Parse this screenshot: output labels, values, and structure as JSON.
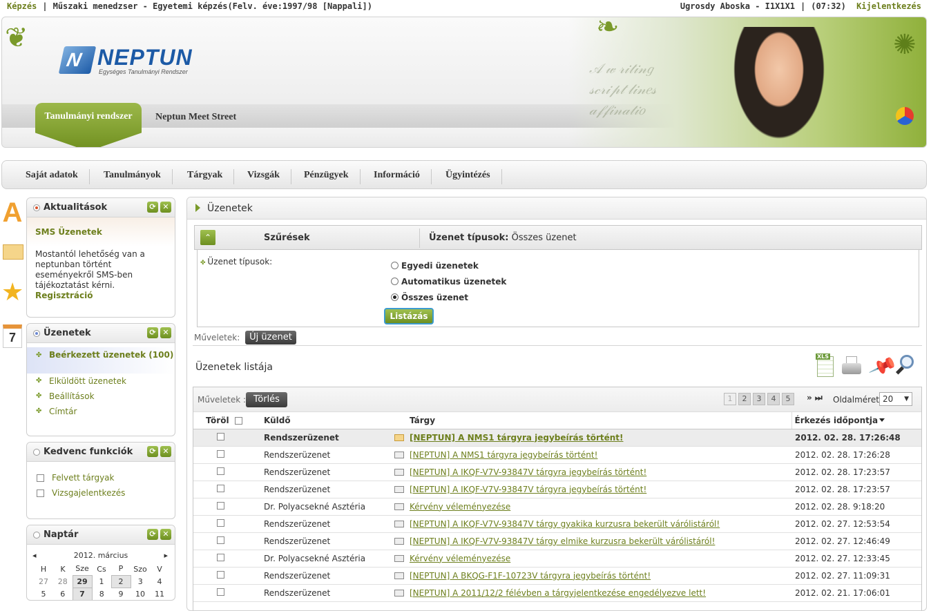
{
  "topbar": {
    "kepzes": "Képzés",
    "program": "Műszaki menedzser - Egyetemi képzés(Felv. éve:1997/98 [Nappali])",
    "user": "Ugrosdy Aboska - I1X1X1",
    "time": "(07:32)",
    "logout": "Kijelentkezés"
  },
  "header": {
    "logo_text": "NEPTUN",
    "logo_mark": "N",
    "logo_sub": "Egységes Tanulmányi Rendszer",
    "tab_active": "Tanulmányi rendszer",
    "tab_other": "Neptun Meet Street"
  },
  "menu": [
    "Saját adatok",
    "Tanulmányok",
    "Tárgyak",
    "Vizsgák",
    "Pénzügyek",
    "Információ",
    "Ügyintézés"
  ],
  "side_icons": {
    "aktual_letter": "A",
    "calendar_day": "7"
  },
  "aktualitasok": {
    "title": "Aktualitások",
    "sms_title": "SMS Üzenetek",
    "text": "Mostantól lehetőség van a neptunban történt eseményekről SMS-ben tájékoztatást kérni.",
    "link": "Regisztráció"
  },
  "uzenetek_box": {
    "title": "Üzenetek",
    "items": [
      "Beérkezett üzenetek (100)",
      "Elküldött üzenetek",
      "Beállítások",
      "Címtár"
    ]
  },
  "kedvenc": {
    "title": "Kedvenc funkciók",
    "items": [
      "Felvett tárgyak",
      "Vizsgajelentkezés"
    ]
  },
  "naptar": {
    "title": "Naptár",
    "month": "2012. március",
    "prev": "◂",
    "next": "▸",
    "days": [
      "H",
      "K",
      "Sze",
      "Cs",
      "P",
      "Szo",
      "V"
    ],
    "week1": [
      "27",
      "28",
      "29",
      "1",
      "2",
      "3",
      "4"
    ],
    "week2": [
      "5",
      "6",
      "7",
      "8",
      "9",
      "10",
      "11"
    ]
  },
  "main": {
    "title": "Üzenetek",
    "filter_label": "Szűrések",
    "filter_type_label": "Üzenet típusok:",
    "filter_type_value": "Összes üzenet",
    "radio_label": "Üzenet típusok:",
    "radios": [
      "Egyedi üzenetek",
      "Automatikus üzenetek",
      "Összes üzenet"
    ],
    "radio_selected": 2,
    "list_button": "Listázás",
    "muveletek": "Műveletek:",
    "new_msg": "Új üzenet",
    "list_title": "Üzenetek listája",
    "tools": [
      "xls-icon",
      "print-icon",
      "pin-icon",
      "zoom-icon"
    ],
    "xls_tag": "XLS",
    "grid_muveletek": "Műveletek :",
    "delete_btn": "Törlés",
    "pages": [
      "1",
      "2",
      "3",
      "4",
      "5"
    ],
    "page_nav": "»  ⏭",
    "page_size_label": "Oldalméret",
    "page_size": "20",
    "columns": {
      "torol": "Töröl",
      "kuldo": "Küldő",
      "targy": "Tárgy",
      "erkezes": "Érkezés időpontja"
    },
    "rows": [
      {
        "sender": "Rendszerüzenet",
        "subject": "[NEPTUN] A NMS1 tárgyra jegybeírás történt!",
        "date": "2012. 02. 28. 17:26:48",
        "unread": true
      },
      {
        "sender": "Rendszerüzenet",
        "subject": "[NEPTUN] A NMS1 tárgyra jegybeírás történt!",
        "date": "2012. 02. 28. 17:26:28",
        "unread": false
      },
      {
        "sender": "Rendszerüzenet",
        "subject": "[NEPTUN] A IKQF-V7V-93847V tárgyra jegybeírás történt!",
        "date": "2012. 02. 28. 17:23:57",
        "unread": false
      },
      {
        "sender": "Rendszerüzenet",
        "subject": "[NEPTUN] A IKQF-V7V-93847V tárgyra jegybeírás történt!",
        "date": "2012. 02. 28. 17:23:57",
        "unread": false
      },
      {
        "sender": "Dr. Polyacsekné Asztéria",
        "subject": "Kérvény véleményezése",
        "date": "2012. 02. 28. 9:18:20",
        "unread": false
      },
      {
        "sender": "Rendszerüzenet",
        "subject": "[NEPTUN] A IKQF-V7V-93847V tárgy gyakika kurzusra bekerült várólistáról!",
        "date": "2012. 02. 27. 12:53:54",
        "unread": false
      },
      {
        "sender": "Rendszerüzenet",
        "subject": "[NEPTUN] A IKQF-V7V-93847V tárgy elmike kurzusra bekerült várólistáról!",
        "date": "2012. 02. 27. 12:46:49",
        "unread": false
      },
      {
        "sender": "Dr. Polyacsekné Asztéria",
        "subject": "Kérvény véleményezése",
        "date": "2012. 02. 27. 12:33:45",
        "unread": false
      },
      {
        "sender": "Rendszerüzenet",
        "subject": "[NEPTUN] A BKQG-F1F-10723V tárgyra jegybeírás történt!",
        "date": "2012. 02. 27. 11:09:31",
        "unread": false
      },
      {
        "sender": "Rendszerüzenet",
        "subject": "[NEPTUN] A 2011/12/2 félévben a tárgyjelentkezése engedélyezve lett!",
        "date": "2012. 02. 21. 17:06:01",
        "unread": false
      }
    ]
  },
  "colors": {
    "olive": "#6d7f1d",
    "green": "#7a9a2a",
    "blue": "#1c5aa6"
  }
}
